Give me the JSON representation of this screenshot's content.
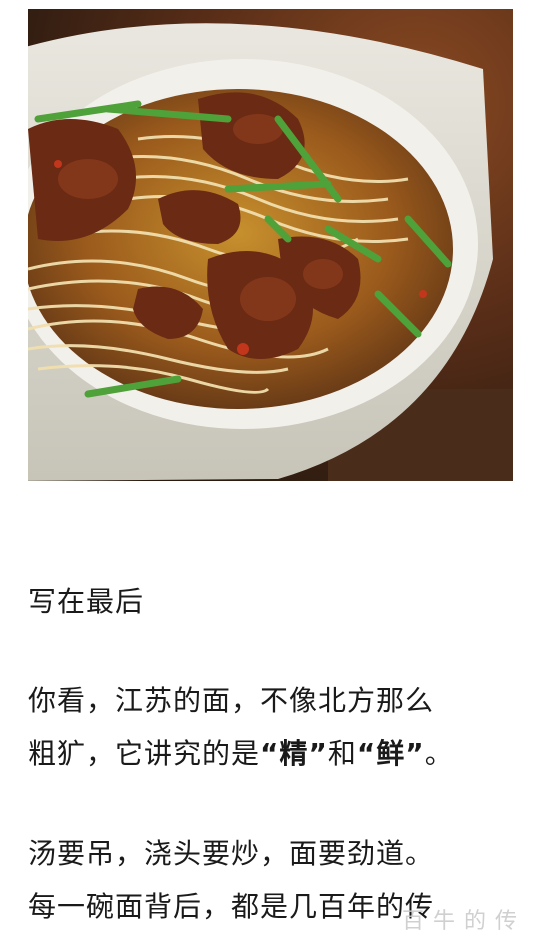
{
  "article": {
    "image_alt": "noodle-soup-photo",
    "section_heading": "写在最后",
    "paragraph1": {
      "line1": "你看，江苏的面，不像北方那么",
      "line2_pre": "粗犷，它讲究的是",
      "q1_open": "“",
      "q1_word": "精",
      "q1_close": "”",
      "and": "和",
      "q2_open": "“",
      "q2_word": "鲜",
      "q2_close": "”",
      "end": "。"
    },
    "paragraph2": {
      "line1": "汤要吊，浇头要炒，面要劲道。",
      "line2": "每一碗面背后，都是几百年的传"
    }
  },
  "watermark": "百 牛 的 传"
}
